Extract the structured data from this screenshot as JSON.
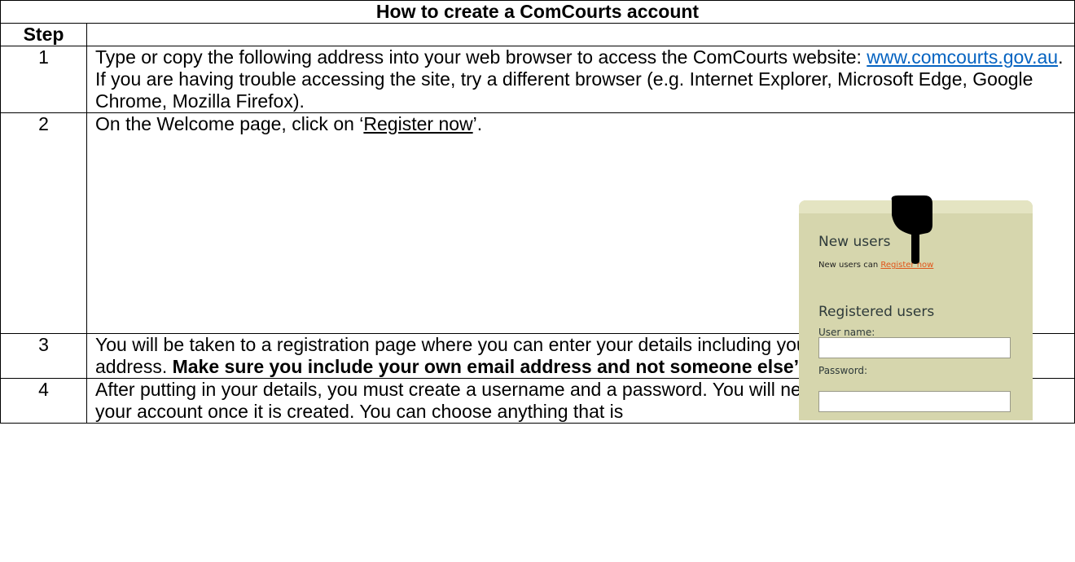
{
  "title": "How to create a ComCourts account",
  "step_header": "Step",
  "steps": [
    {
      "num": "1",
      "text_a": "Type or copy the following address into your web browser to access the ComCourts website: ",
      "link": "www.comcourts.gov.au",
      "text_b": ". If you are having trouble accessing the site, try a different browser (e.g. Internet Explorer, Microsoft Edge, Google Chrome, Mozilla Firefox)."
    },
    {
      "num": "2",
      "text_a": "On the Welcome page, click on ‘",
      "underlined": "Register now",
      "text_b": "’."
    },
    {
      "num": "3",
      "text_a": "You will be taken to a registration page where you can enter your details including your name, phone and email address. ",
      "bold": "Make sure you include your own email address and not someone else’s."
    },
    {
      "num": "4",
      "text_a": "After putting in your details, you must create a username and a password. You will need both of these to log-in to your account once it is created. You can choose anything that is"
    }
  ],
  "screenshot": {
    "new_users_heading": "New users",
    "new_users_text": "New users can ",
    "register_link": "Register now",
    "registered_heading": "Registered users",
    "username_label": "User name:",
    "password_label": "Password:"
  }
}
